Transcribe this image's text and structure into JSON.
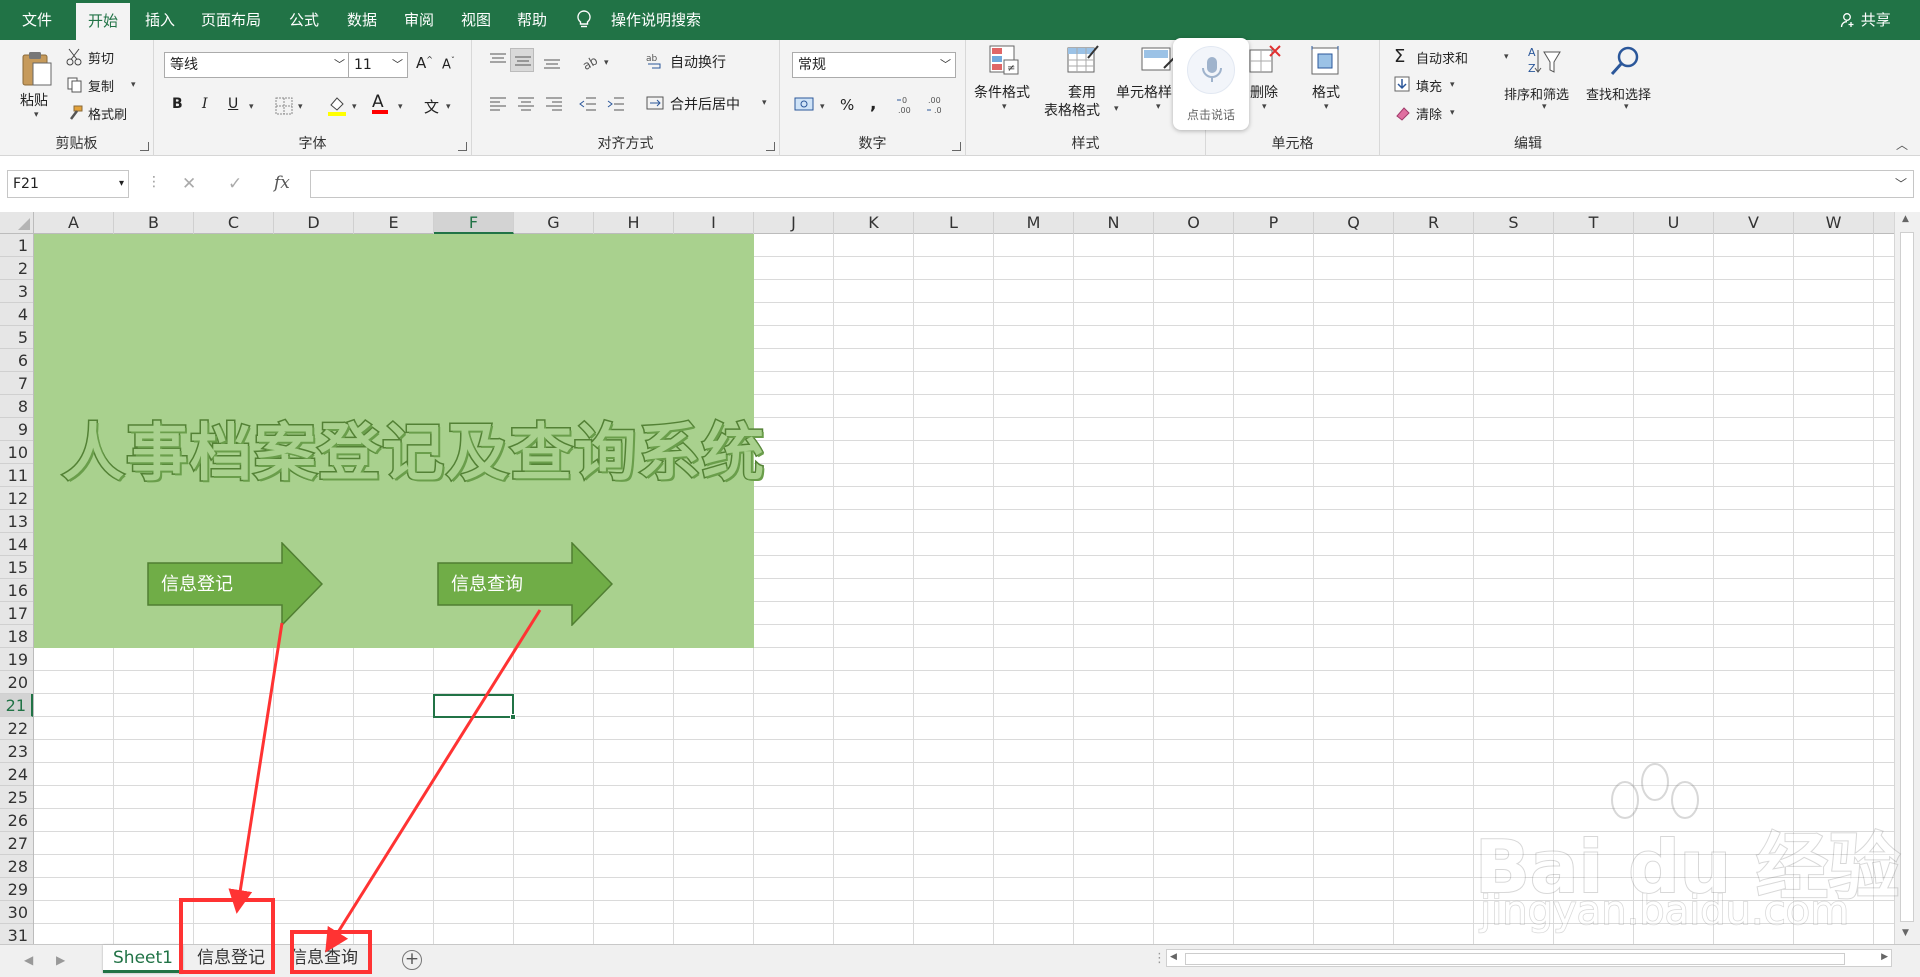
{
  "ribbon_tabs": [
    "文件",
    "开始",
    "插入",
    "页面布局",
    "公式",
    "数据",
    "审阅",
    "视图",
    "帮助"
  ],
  "tell_me": "操作说明搜索",
  "share": "共享",
  "clipboard": {
    "paste": "粘贴",
    "cut": "剪切",
    "copy": "复制",
    "format_painter": "格式刷",
    "group": "剪贴板"
  },
  "font": {
    "name": "等线",
    "size": "11",
    "bold": "B",
    "italic": "I",
    "underline": "U",
    "font_color_glyph": "A",
    "phonetic_glyph": "文",
    "grow_glyph": "A",
    "shrink_glyph": "A",
    "group": "字体"
  },
  "alignment": {
    "wrap": "自动换行",
    "merge": "合并后居中",
    "group": "对齐方式"
  },
  "number": {
    "format": "常规",
    "percent": "%",
    "comma": ",",
    "group": "数字"
  },
  "styles": {
    "conditional": "条件格式",
    "table_1": "套用",
    "table_2": "表格格式",
    "cell_styles": "单元格样",
    "group": "样式"
  },
  "cells": {
    "delete": "删除",
    "format": "格式",
    "group": "单元格"
  },
  "editing": {
    "autosum": "自动求和",
    "fill": "填充",
    "clear": "清除",
    "sort_filter": "排序和筛选",
    "find_select": "查找和选择",
    "group": "编辑"
  },
  "voice": {
    "label": "点击说话"
  },
  "formula_bar": {
    "name_box": "F21",
    "cancel": "✕",
    "enter": "✓",
    "fx": "fx",
    "formula": ""
  },
  "columns": [
    "A",
    "B",
    "C",
    "D",
    "E",
    "F",
    "G",
    "H",
    "I",
    "J",
    "K",
    "L",
    "M",
    "N",
    "O",
    "P",
    "Q",
    "R",
    "S",
    "T",
    "U",
    "V",
    "W"
  ],
  "rows": [
    "1",
    "2",
    "3",
    "4",
    "5",
    "6",
    "7",
    "8",
    "9",
    "10",
    "11",
    "12",
    "13",
    "14",
    "15",
    "16",
    "17",
    "18",
    "19",
    "20",
    "21",
    "22",
    "23",
    "24",
    "25",
    "26",
    "27",
    "28",
    "29",
    "30",
    "31"
  ],
  "selected_cell": {
    "column": "F",
    "row": "21"
  },
  "banner": {
    "title": "人事档案登记及查询系统",
    "bg_color": "#a9d18e"
  },
  "buttons": {
    "register": "信息登记",
    "query": "信息查询",
    "color": "#70ad47"
  },
  "sheets": [
    {
      "name": "Sheet1",
      "active": true
    },
    {
      "name": "信息登记",
      "active": false
    },
    {
      "name": "信息查询",
      "active": false
    }
  ],
  "add_sheet": "+",
  "watermark": {
    "main": "Bai du 经验",
    "sub": "jingyan.baidu.com"
  },
  "colors": {
    "accent": "#217346",
    "annotation": "#ff3333"
  }
}
